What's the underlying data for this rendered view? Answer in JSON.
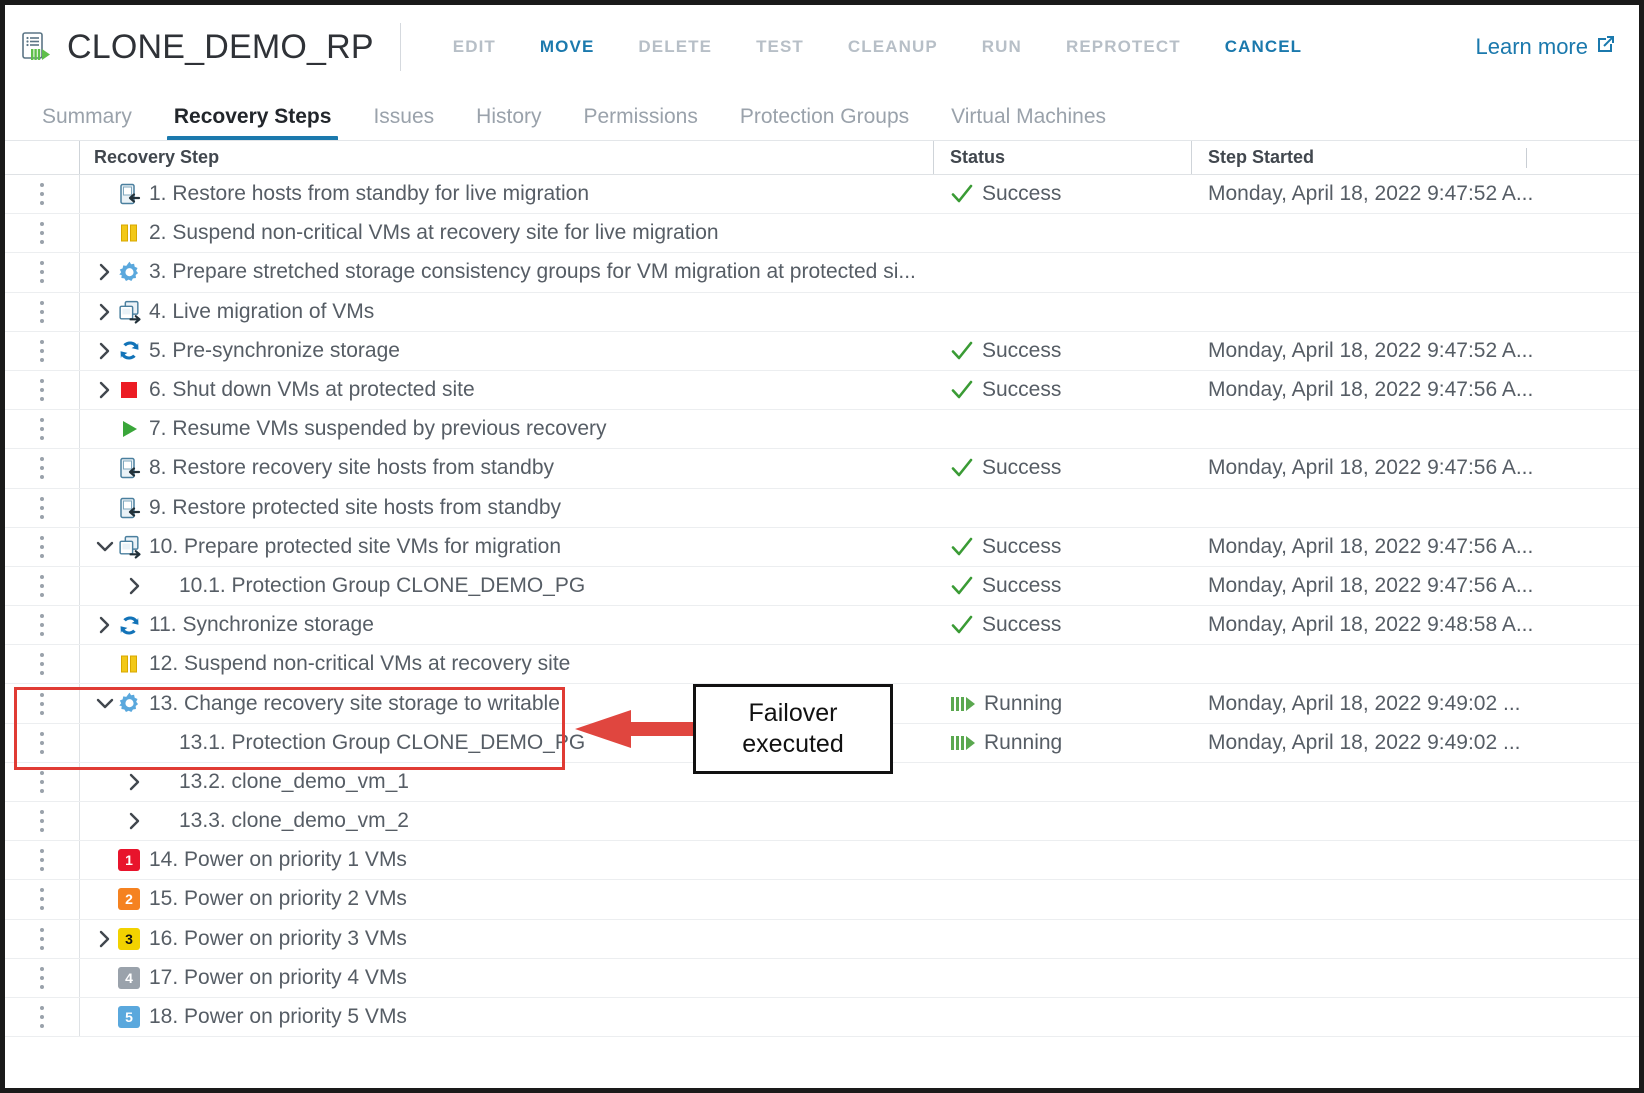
{
  "header": {
    "title": "CLONE_DEMO_RP",
    "app_icon": "recovery-plan-icon",
    "learn_more": "Learn more",
    "external_link_icon": "external-link-icon",
    "actions": [
      {
        "label": "EDIT",
        "enabled": false
      },
      {
        "label": "MOVE",
        "enabled": true
      },
      {
        "label": "DELETE",
        "enabled": false
      },
      {
        "label": "TEST",
        "enabled": false
      },
      {
        "label": "CLEANUP",
        "enabled": false
      },
      {
        "label": "RUN",
        "enabled": false
      },
      {
        "label": "REPROTECT",
        "enabled": false
      },
      {
        "label": "CANCEL",
        "enabled": true
      }
    ]
  },
  "tabs": [
    {
      "label": "Summary",
      "active": false
    },
    {
      "label": "Recovery Steps",
      "active": true
    },
    {
      "label": "Issues",
      "active": false
    },
    {
      "label": "History",
      "active": false
    },
    {
      "label": "Permissions",
      "active": false
    },
    {
      "label": "Protection Groups",
      "active": false
    },
    {
      "label": "Virtual Machines",
      "active": false
    }
  ],
  "table": {
    "columns": [
      "Recovery Step",
      "Status",
      "Step Started"
    ],
    "rows": [
      {
        "indent": 0,
        "caret": "none",
        "icon": "restore-host-icon",
        "step": "1. Restore hosts from standby for live migration",
        "status": "Success",
        "status_icon": "check-icon",
        "started": "Monday, April 18, 2022 9:47:52 A..."
      },
      {
        "indent": 0,
        "caret": "none",
        "icon": "pause-icon",
        "step": "2. Suspend non-critical VMs at recovery site for live migration",
        "status": "",
        "status_icon": "",
        "started": ""
      },
      {
        "indent": 0,
        "caret": "collapsed",
        "icon": "gear-icon",
        "step": "3. Prepare stretched storage consistency groups for VM migration at protected si...",
        "status": "",
        "status_icon": "",
        "started": ""
      },
      {
        "indent": 0,
        "caret": "collapsed",
        "icon": "vm-migrate-icon",
        "step": "4. Live migration of VMs",
        "status": "",
        "status_icon": "",
        "started": ""
      },
      {
        "indent": 0,
        "caret": "collapsed",
        "icon": "sync-icon",
        "step": "5. Pre-synchronize storage",
        "status": "Success",
        "status_icon": "check-icon",
        "started": "Monday, April 18, 2022 9:47:52 A..."
      },
      {
        "indent": 0,
        "caret": "collapsed",
        "icon": "stop-icon",
        "step": "6. Shut down VMs at protected site",
        "status": "Success",
        "status_icon": "check-icon",
        "started": "Monday, April 18, 2022 9:47:56 A..."
      },
      {
        "indent": 0,
        "caret": "none",
        "icon": "play-icon",
        "step": "7. Resume VMs suspended by previous recovery",
        "status": "",
        "status_icon": "",
        "started": ""
      },
      {
        "indent": 0,
        "caret": "none",
        "icon": "restore-host-icon",
        "step": "8. Restore recovery site hosts from standby",
        "status": "Success",
        "status_icon": "check-icon",
        "started": "Monday, April 18, 2022 9:47:56 A..."
      },
      {
        "indent": 0,
        "caret": "none",
        "icon": "restore-host-icon",
        "step": "9. Restore protected site hosts from standby",
        "status": "",
        "status_icon": "",
        "started": ""
      },
      {
        "indent": 0,
        "caret": "expanded",
        "icon": "vm-migrate-icon",
        "step": "10. Prepare protected site VMs for migration",
        "status": "Success",
        "status_icon": "check-icon",
        "started": "Monday, April 18, 2022 9:47:56 A..."
      },
      {
        "indent": 1,
        "caret": "collapsed",
        "icon": "none",
        "step": "10.1. Protection Group CLONE_DEMO_PG",
        "status": "Success",
        "status_icon": "check-icon",
        "started": "Monday, April 18, 2022 9:47:56 A..."
      },
      {
        "indent": 0,
        "caret": "collapsed",
        "icon": "sync-icon",
        "step": "11. Synchronize storage",
        "status": "Success",
        "status_icon": "check-icon",
        "started": "Monday, April 18, 2022 9:48:58 A..."
      },
      {
        "indent": 0,
        "caret": "none",
        "icon": "pause-icon",
        "step": "12. Suspend non-critical VMs at recovery site",
        "status": "",
        "status_icon": "",
        "started": ""
      },
      {
        "indent": 0,
        "caret": "expanded",
        "icon": "gear-icon",
        "step": "13. Change recovery site storage to writable",
        "status": "Running",
        "status_icon": "running-icon",
        "started": "Monday, April 18, 2022 9:49:02 ..."
      },
      {
        "indent": 1,
        "caret": "none",
        "icon": "none",
        "step": "13.1. Protection Group CLONE_DEMO_PG",
        "status": "Running",
        "status_icon": "running-icon",
        "started": "Monday, April 18, 2022 9:49:02 ..."
      },
      {
        "indent": 1,
        "caret": "collapsed",
        "icon": "none",
        "step": "13.2. clone_demo_vm_1",
        "status": "",
        "status_icon": "",
        "started": ""
      },
      {
        "indent": 1,
        "caret": "collapsed",
        "icon": "none",
        "step": "13.3. clone_demo_vm_2",
        "status": "",
        "status_icon": "",
        "started": ""
      },
      {
        "indent": 0,
        "caret": "none",
        "icon": "priority-1-badge",
        "step": "14. Power on priority 1 VMs",
        "status": "",
        "status_icon": "",
        "started": ""
      },
      {
        "indent": 0,
        "caret": "none",
        "icon": "priority-2-badge",
        "step": "15. Power on priority 2 VMs",
        "status": "",
        "status_icon": "",
        "started": ""
      },
      {
        "indent": 0,
        "caret": "collapsed",
        "icon": "priority-3-badge",
        "step": "16. Power on priority 3 VMs",
        "status": "",
        "status_icon": "",
        "started": ""
      },
      {
        "indent": 0,
        "caret": "none",
        "icon": "priority-4-badge",
        "step": "17. Power on priority 4 VMs",
        "status": "",
        "status_icon": "",
        "started": ""
      },
      {
        "indent": 0,
        "caret": "none",
        "icon": "priority-5-badge",
        "step": "18. Power on priority 5 VMs",
        "status": "",
        "status_icon": "",
        "started": ""
      }
    ]
  },
  "annotation": {
    "callout_line1": "Failover",
    "callout_line2": "executed",
    "highlight_color": "#e03b34",
    "arrow_color": "#e0463f",
    "callout_border_color": "#111111"
  },
  "colors": {
    "accent": "#1b79ad",
    "success": "#3a9b35",
    "running": "#5aa84f",
    "priority1": "#e8142c",
    "priority2": "#f58220",
    "priority3": "#f2d200",
    "priority4": "#9aa2ab",
    "priority5": "#5aa8dd"
  }
}
